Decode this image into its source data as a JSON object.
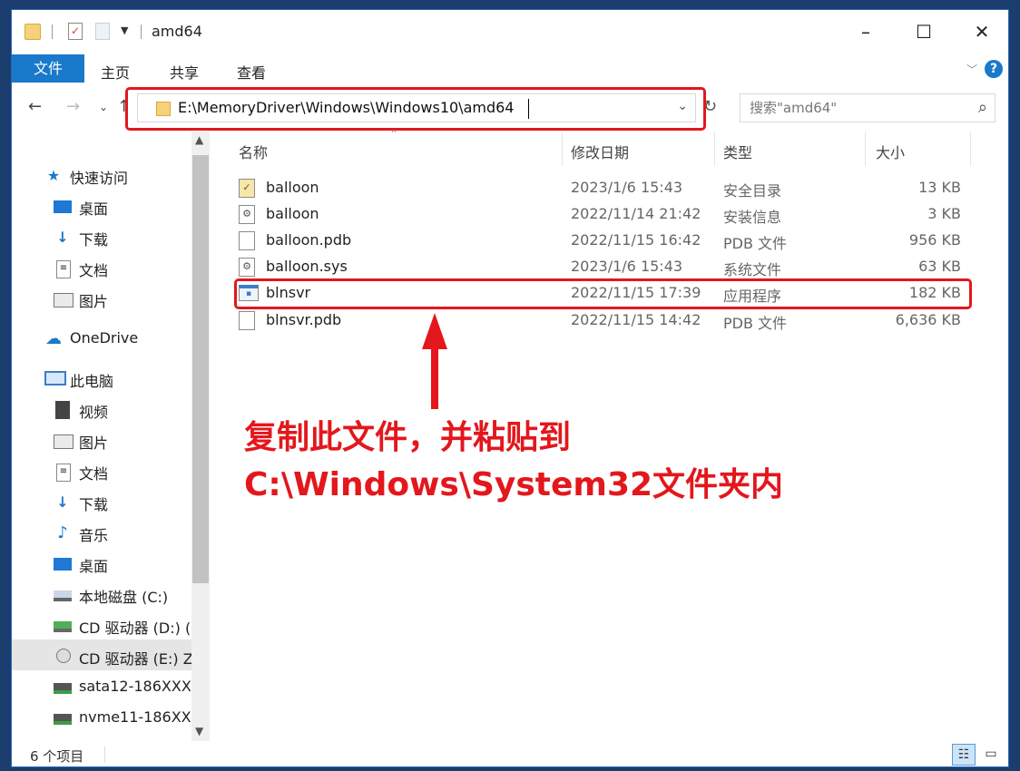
{
  "window": {
    "title": "amd64",
    "minimize": "–",
    "maximize": "☐",
    "close": "✕"
  },
  "ribbon": {
    "tabs": [
      "文件",
      "主页",
      "共享",
      "查看"
    ]
  },
  "address": {
    "path": "E:\\MemoryDriver\\Windows\\Windows10\\amd64",
    "search_placeholder": "搜索\"amd64\""
  },
  "nav": {
    "quick_access": "快速访问",
    "quick_items": [
      "桌面",
      "下载",
      "文档",
      "图片"
    ],
    "onedrive": "OneDrive",
    "this_pc": "此电脑",
    "pc_items": [
      "视频",
      "图片",
      "文档",
      "下载",
      "音乐",
      "桌面"
    ],
    "drives": [
      "本地磁盘 (C:)",
      "CD 驱动器 (D:) (",
      "CD 驱动器 (E:) Z",
      "sata12-186XXX",
      "nvme11-186XX"
    ]
  },
  "columns": {
    "name": "名称",
    "date": "修改日期",
    "type": "类型",
    "size": "大小"
  },
  "files": [
    {
      "name": "balloon",
      "date": "2023/1/6 15:43",
      "type": "安全目录",
      "size": "13 KB",
      "icon": "security-catalog-icon"
    },
    {
      "name": "balloon",
      "date": "2022/11/14 21:42",
      "type": "安装信息",
      "size": "3 KB",
      "icon": "setup-info-icon"
    },
    {
      "name": "balloon.pdb",
      "date": "2022/11/15 16:42",
      "type": "PDB 文件",
      "size": "956 KB",
      "icon": "file-icon"
    },
    {
      "name": "balloon.sys",
      "date": "2023/1/6 15:43",
      "type": "系统文件",
      "size": "63 KB",
      "icon": "system-file-icon"
    },
    {
      "name": "blnsvr",
      "date": "2022/11/15 17:39",
      "type": "应用程序",
      "size": "182 KB",
      "icon": "application-icon"
    },
    {
      "name": "blnsvr.pdb",
      "date": "2022/11/15 14:42",
      "type": "PDB 文件",
      "size": "6,636 KB",
      "icon": "file-icon"
    }
  ],
  "annotation": {
    "line1": "复制此文件，并粘贴到",
    "line2": "C:\\Windows\\System32文件夹内"
  },
  "status": {
    "count": "6 个项目"
  },
  "colors": {
    "accent": "#1979ca",
    "annotation_red": "#e3171c"
  }
}
